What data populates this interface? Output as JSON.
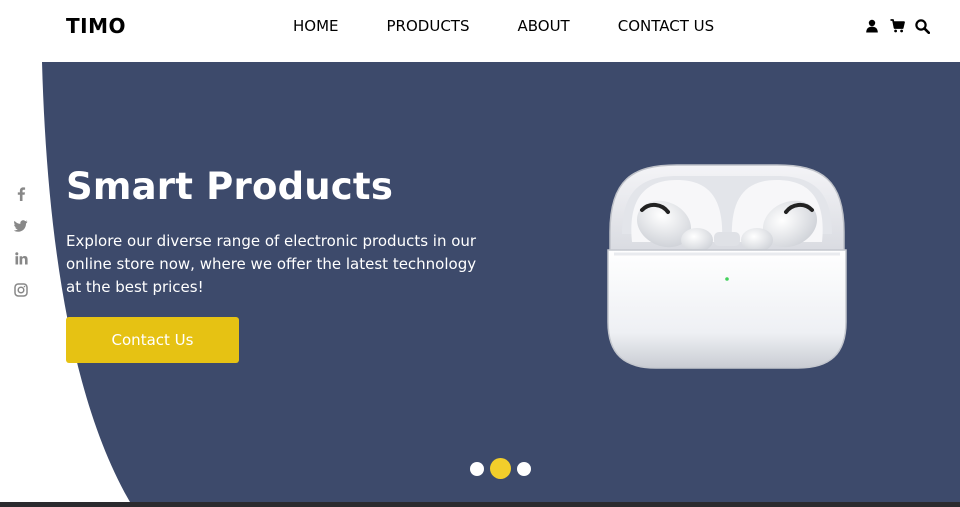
{
  "header": {
    "logo": "TIMO",
    "nav": [
      "HOME",
      "PRODUCTS",
      "ABOUT",
      "CONTACT US"
    ],
    "icons": [
      "user-icon",
      "cart-icon",
      "search-icon"
    ]
  },
  "hero": {
    "title": "Smart Products",
    "description": "Explore our diverse range of electronic products in our online store now, where we offer the latest technology at the best prices!",
    "cta_label": "Contact Us",
    "product_image": "airpods-pro-case",
    "slides": {
      "count": 3,
      "active": 2
    }
  },
  "social": [
    "facebook-icon",
    "twitter-icon",
    "linkedin-icon",
    "instagram-icon"
  ],
  "colors": {
    "hero_bg": "#3d4a6b",
    "accent": "#e6c213",
    "active_dot": "#f2ce2b",
    "social_icon": "#888888"
  }
}
